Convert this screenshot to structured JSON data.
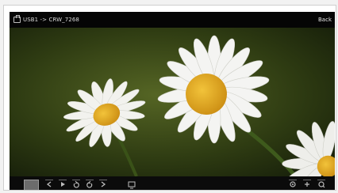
{
  "header": {
    "path": "USB1 -> CRW_7268",
    "back_label": "Back",
    "usb_icon": "usb-drive-icon"
  },
  "image": {
    "subject": "daisies photo",
    "background_color": "#27340f"
  },
  "toolbar": {
    "thumbnail_icon": "thumbnail-icon",
    "controls": [
      "previous-icon",
      "play-icon",
      "rotate-left-icon",
      "rotate-right-icon",
      "next-icon",
      "slideshow-icon"
    ],
    "right_controls": [
      "zoom-icon",
      "info-icon",
      "settings-icon"
    ]
  }
}
